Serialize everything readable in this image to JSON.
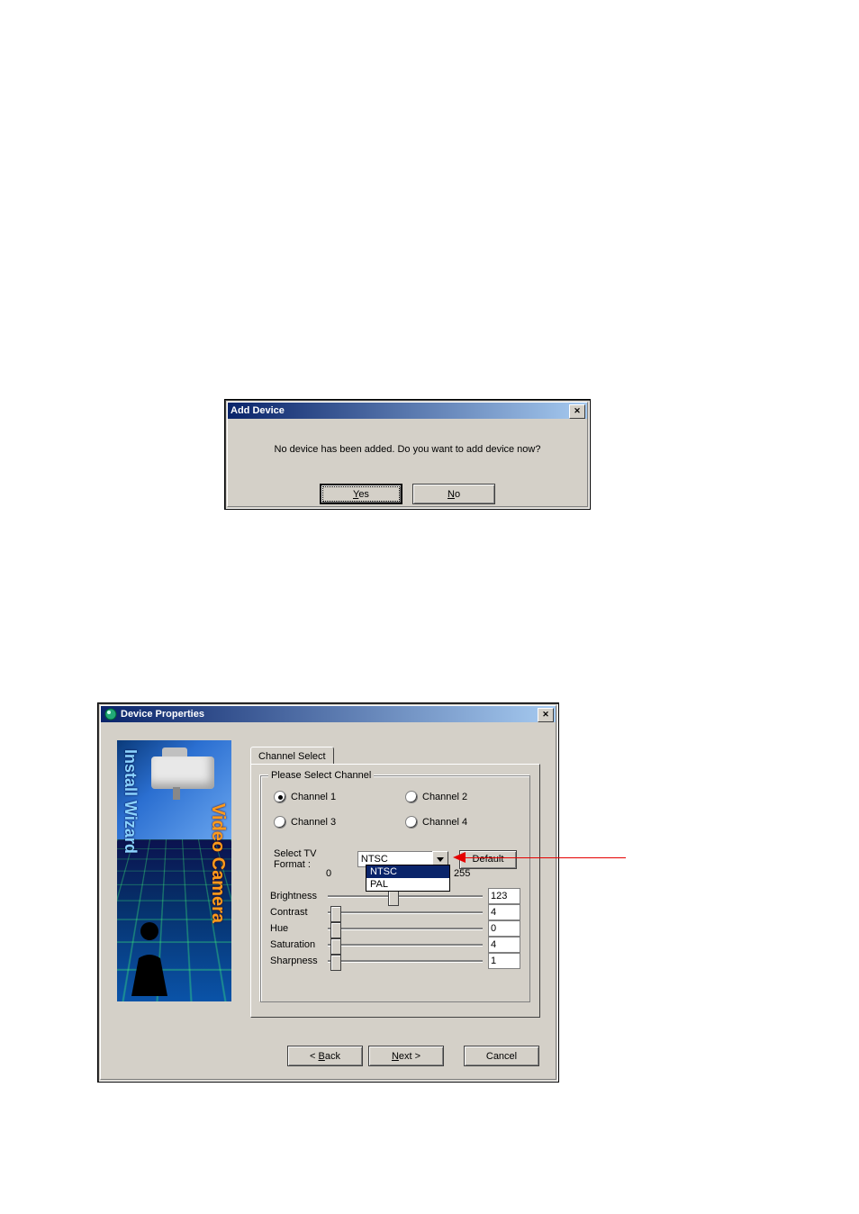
{
  "dialog1": {
    "title": "Add Device",
    "message": "No device has been added. Do you want to add device now?",
    "yes_label_pre": "",
    "yes_label_u": "Y",
    "yes_label_post": "es",
    "no_label_pre": "",
    "no_label_u": "N",
    "no_label_post": "o"
  },
  "dialog2": {
    "title": "Device Properties",
    "sidebar_text_blue": "Install Wizard",
    "sidebar_text_orange": "Video Camera",
    "tab_label": "Channel Select",
    "group_label": "Please Select Channel",
    "channels": {
      "c1": "Channel 1",
      "c2": "Channel 2",
      "c3": "Channel 3",
      "c4": "Channel 4",
      "selected": "c1"
    },
    "tv_format_label": "Select TV  Format :",
    "tv_format_value": "NTSC",
    "tv_format_options": [
      "NTSC",
      "PAL"
    ],
    "default_button": "Default",
    "range_min": "0",
    "range_max": "255",
    "sliders": {
      "brightness": {
        "label": "Brightness",
        "value": "123",
        "pos": 0.48
      },
      "contrast": {
        "label": "Contrast",
        "value": "4",
        "pos": 0.02
      },
      "hue": {
        "label": "Hue",
        "value": "0",
        "pos": 0.02
      },
      "saturation": {
        "label": "Saturation",
        "value": "4",
        "pos": 0.02
      },
      "sharpness": {
        "label": "Sharpness",
        "value": "1",
        "pos": 0.02
      }
    },
    "back_pre": "< ",
    "back_u": "B",
    "back_post": "ack",
    "next_u": "N",
    "next_post": "ext >",
    "cancel": "Cancel"
  }
}
